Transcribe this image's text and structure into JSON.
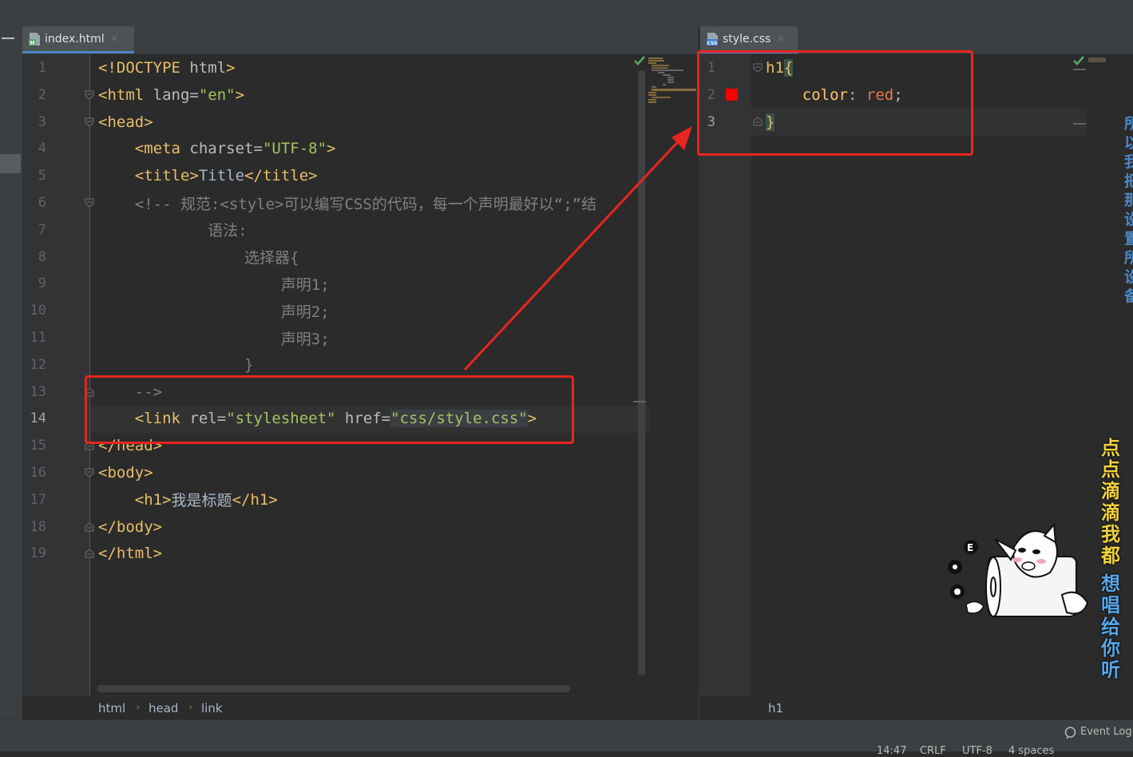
{
  "tabs": {
    "left": {
      "name": "index.html",
      "close": "×"
    },
    "right": {
      "name": "style.css",
      "close": "×"
    }
  },
  "html_file": {
    "line_numbers": [
      "1",
      "2",
      "3",
      "4",
      "5",
      "6",
      "7",
      "8",
      "9",
      "10",
      "11",
      "12",
      "13",
      "14",
      "15",
      "16",
      "17",
      "18",
      "19"
    ],
    "current_line": "14",
    "lines": [
      {
        "text": "<!DOCTYPE html>"
      },
      {
        "text": "<html lang=\"en\">"
      },
      {
        "text": "<head>"
      },
      {
        "text": "    <meta charset=\"UTF-8\">"
      },
      {
        "text": "    <title>Title</title>"
      },
      {
        "text": "    <!-- 规范:<style>可以编写CSS的代码，每一个声明最好以“;”结"
      },
      {
        "text": "            语法:"
      },
      {
        "text": "                选择器{"
      },
      {
        "text": "                    声明1;"
      },
      {
        "text": "                    声明2;"
      },
      {
        "text": "                    声明3;"
      },
      {
        "text": "                }"
      },
      {
        "text": "    -->"
      },
      {
        "text": "    <link rel=\"stylesheet\" href=\"css/style.css\">"
      },
      {
        "text": "</head>"
      },
      {
        "text": "<body>"
      },
      {
        "text": "    <h1>我是标题</h1>"
      },
      {
        "text": "</body>"
      },
      {
        "text": "</html>"
      }
    ]
  },
  "css_file": {
    "line_numbers": [
      "1",
      "2",
      "3"
    ],
    "selector": "h1",
    "open_brace": "{",
    "property": "color",
    "colon": ":",
    "value": "red",
    "semicolon": ";",
    "close_brace": "}",
    "color_swatch": "#ff0000"
  },
  "breadcrumbs": {
    "left": [
      "html",
      "head",
      "link"
    ],
    "right": [
      "h1"
    ]
  },
  "status": {
    "event_log": "Event Log",
    "position": "14:47",
    "line_sep": "CRLF",
    "encoding": "UTF-8",
    "indent": "4 spaces"
  },
  "overlay": {
    "lyric_chars": [
      "点",
      "点",
      "滴",
      "滴",
      "我",
      "都",
      "想",
      "唱",
      "给",
      "你",
      "听"
    ],
    "edge_chars": [
      "所",
      "以",
      "我",
      "把",
      "那",
      "设",
      "置",
      "所",
      "设",
      "备"
    ],
    "annotation_color": "#e8251f"
  },
  "icons": {
    "check": "checkmark-icon",
    "html_file": "html-file-icon",
    "css_file": "css-file-icon",
    "event_log": "event-log-icon"
  }
}
